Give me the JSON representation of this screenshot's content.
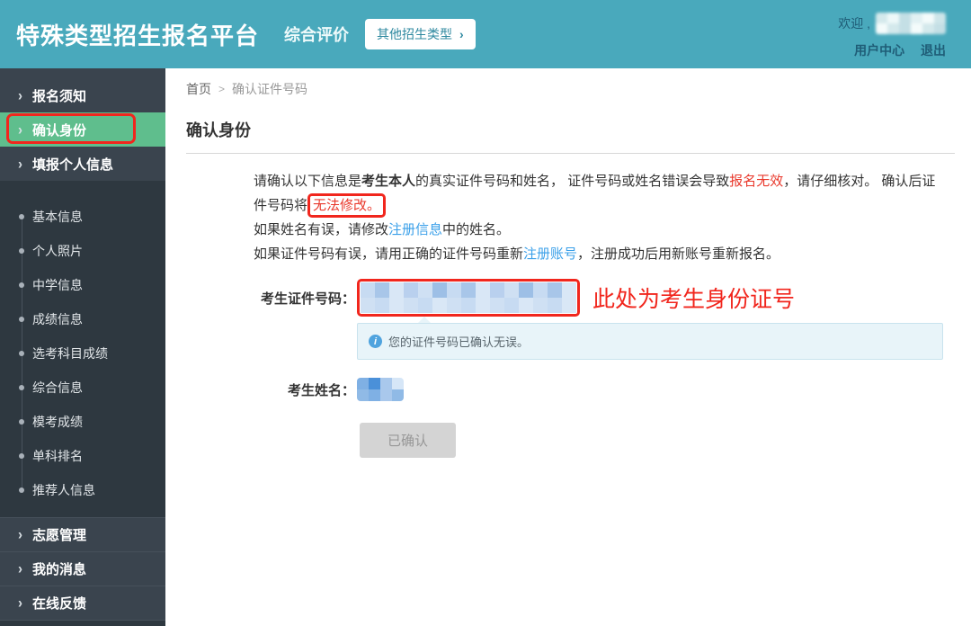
{
  "header": {
    "title": "特殊类型招生报名平台",
    "subtitle": "综合评价",
    "other_types_button": "其他招生类型",
    "welcome": "欢迎 ,",
    "user_center": "用户中心",
    "logout": "退出"
  },
  "icons": {
    "chevron_right": "›",
    "breadcrumb_separator": ">",
    "info": "i"
  },
  "sidebar": {
    "items": [
      {
        "label": "报名须知",
        "type": "top",
        "active": false
      },
      {
        "label": "确认身份",
        "type": "top",
        "active": true
      },
      {
        "label": "填报个人信息",
        "type": "top",
        "active": false
      },
      {
        "label": "基本信息",
        "type": "sub"
      },
      {
        "label": "个人照片",
        "type": "sub"
      },
      {
        "label": "中学信息",
        "type": "sub"
      },
      {
        "label": "成绩信息",
        "type": "sub"
      },
      {
        "label": "选考科目成绩",
        "type": "sub"
      },
      {
        "label": "综合信息",
        "type": "sub"
      },
      {
        "label": "模考成绩",
        "type": "sub"
      },
      {
        "label": "单科排名",
        "type": "sub"
      },
      {
        "label": "推荐人信息",
        "type": "sub"
      },
      {
        "label": "志愿管理",
        "type": "top",
        "active": false
      },
      {
        "label": "我的消息",
        "type": "top",
        "active": false
      },
      {
        "label": "在线反馈",
        "type": "top",
        "active": false
      }
    ]
  },
  "breadcrumb": {
    "home": "首页",
    "current": "确认证件号码"
  },
  "page": {
    "title": "确认身份",
    "intro": {
      "l1_a": "请确认以下信息是",
      "l1_b": "考生本人",
      "l1_c": "的真实证件号码和姓名， 证件号码或姓名错误会导致",
      "l1_d": "报名无效",
      "l1_e": "，请仔细核对。 确认后证",
      "l2_a": "件号码将",
      "l2_b": "无法修改。",
      "p2_a": "如果姓名有误，请修改",
      "p2_link": "注册信息",
      "p2_b": "中的姓名。",
      "p3_a": "如果证件号码有误，请用正确的证件号码重新",
      "p3_link": "注册账号",
      "p3_b": "，注册成功后用新账号重新报名。"
    },
    "form": {
      "id_label": "考生证件号码：",
      "id_annotation": "此处为考生身份证号",
      "id_confirmed_message": "您的证件号码已确认无误。",
      "name_label": "考生姓名：",
      "confirmed_button": "已确认"
    }
  },
  "colors": {
    "header_bg": "#49a9bc",
    "sidebar_top_bg": "#3a444e",
    "sidebar_sub_bg": "#2e3840",
    "active_green": "#5fbe8d",
    "annotation_red": "#f1261d",
    "warning_text_red": "#e9392c",
    "link_blue": "#3ba0e9",
    "info_box_bg": "#e8f4f9",
    "info_box_border": "#c9e3ee",
    "disabled_button_bg": "#d4d4d4"
  }
}
